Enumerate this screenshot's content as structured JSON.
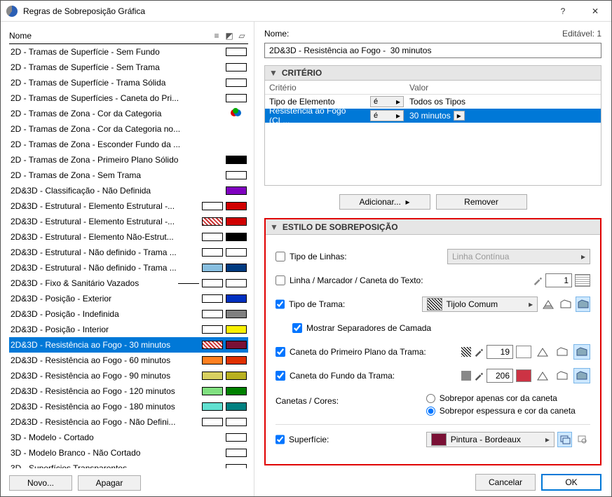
{
  "window": {
    "title": "Regras de Sobreposição Gráfica"
  },
  "left": {
    "header": "Nome",
    "buttons": {
      "new": "Novo...",
      "delete": "Apagar"
    },
    "items": [
      {
        "label": "2D - Tramas de Superfície - Sem Fundo",
        "sw": [
          {
            "c": "#ffffff"
          }
        ]
      },
      {
        "label": "2D - Tramas de Superfície - Sem Trama",
        "sw": [
          {
            "c": "#ffffff"
          }
        ]
      },
      {
        "label": "2D - Tramas de Superfície - Trama Sólida",
        "sw": [
          {
            "c": "#ffffff"
          }
        ]
      },
      {
        "label": "2D - Tramas de Superfícies - Caneta do Pri...",
        "sw": [
          {
            "c": "#ffffff"
          }
        ]
      },
      {
        "label": "2D - Tramas de Zona - Cor da Categoria",
        "category": true
      },
      {
        "label": "2D - Tramas de Zona - Cor da Categoria no...",
        "sw": []
      },
      {
        "label": "2D - Tramas de Zona - Esconder Fundo da ...",
        "sw": []
      },
      {
        "label": "2D - Tramas de Zona - Primeiro Plano Sólido",
        "sw": [
          {
            "c": "#000000"
          }
        ]
      },
      {
        "label": "2D - Tramas de Zona - Sem Trama",
        "sw": [
          {
            "c": "#ffffff"
          }
        ]
      },
      {
        "label": "2D&3D - Classificação - Não Definida",
        "sw": [
          {
            "c": "#8000c0"
          }
        ]
      },
      {
        "label": "2D&3D - Estrutural - Elemento Estrutural -...",
        "sw": [
          {
            "c": "#ffffff"
          },
          {
            "c": "#d00000"
          }
        ]
      },
      {
        "label": "2D&3D - Estrutural - Elemento Estrutural -...",
        "sw": [
          {
            "c": "#ffffff",
            "hatch": true
          },
          {
            "c": "#d00000"
          }
        ]
      },
      {
        "label": "2D&3D - Estrutural - Elemento Não-Estrut...",
        "sw": [
          {
            "c": "#ffffff"
          },
          {
            "c": "#000000"
          }
        ]
      },
      {
        "label": "2D&3D - Estrutural - Não definido - Trama ...",
        "sw": [
          {
            "c": "#ffffff"
          },
          {
            "c": "#ffffff"
          }
        ]
      },
      {
        "label": "2D&3D - Estrutural - Não definido - Trama ...",
        "sw": [
          {
            "c": "#88bfe0"
          },
          {
            "c": "#003a80"
          }
        ]
      },
      {
        "label": "2D&3D - Fixo & Sanitário Vazados",
        "line": true,
        "sw": [
          {
            "c": "#ffffff"
          },
          {
            "c": "#ffffff"
          }
        ]
      },
      {
        "label": "2D&3D - Posição - Exterior",
        "sw": [
          {
            "c": "#ffffff"
          },
          {
            "c": "#0030c0"
          }
        ]
      },
      {
        "label": "2D&3D - Posição - Indefinida",
        "sw": [
          {
            "c": "#ffffff"
          },
          {
            "c": "#808080"
          }
        ]
      },
      {
        "label": "2D&3D - Posição - Interior",
        "sw": [
          {
            "c": "#ffffff"
          },
          {
            "c": "#f8f000"
          }
        ]
      },
      {
        "label": "2D&3D - Resistência ao Fogo -  30 minutos",
        "selected": true,
        "sw": [
          {
            "c": "#ffffff",
            "hatch": true
          },
          {
            "c": "#7a1035"
          }
        ]
      },
      {
        "label": "2D&3D - Resistência ao Fogo -  60 minutos",
        "sw": [
          {
            "c": "#ff8020"
          },
          {
            "c": "#e03000"
          }
        ]
      },
      {
        "label": "2D&3D - Resistência ao Fogo -  90 minutos",
        "sw": [
          {
            "c": "#d8d060"
          },
          {
            "c": "#b8b020"
          }
        ]
      },
      {
        "label": "2D&3D - Resistência ao Fogo - 120 minutos",
        "sw": [
          {
            "c": "#80e080"
          },
          {
            "c": "#008000"
          }
        ]
      },
      {
        "label": "2D&3D - Resistência ao Fogo - 180 minutos",
        "sw": [
          {
            "c": "#60e0d0"
          },
          {
            "c": "#008080"
          }
        ]
      },
      {
        "label": "2D&3D - Resistência ao Fogo - Não Defini...",
        "sw": [
          {
            "c": "#ffffff"
          },
          {
            "c": "#ffffff"
          }
        ]
      },
      {
        "label": "3D - Modelo - Cortado",
        "sw": [
          {
            "c": "#ffffff"
          }
        ]
      },
      {
        "label": "3D - Modelo Branco - Não Cortado",
        "sw": [
          {
            "c": "#ffffff"
          }
        ]
      },
      {
        "label": "3D - Superfícies Transparentes",
        "sw": [
          {
            "c": "#ffffff"
          }
        ]
      }
    ]
  },
  "right": {
    "name_label": "Nome:",
    "editable": "Editável: 1",
    "name_value": "2D&3D - Resistência ao Fogo -  30 minutos",
    "criterio": {
      "title": "CRITÉRIO",
      "col_criterio": "Critério",
      "col_valor": "Valor",
      "rows": [
        {
          "c": "Tipo de Elemento",
          "op": "é",
          "v": "Todos os Tipos",
          "sel": false
        },
        {
          "c": "Resistência ao Fogo (CL...",
          "op": "é",
          "v": "30 minutos",
          "sel": true
        }
      ],
      "add": "Adicionar...",
      "remove": "Remover"
    },
    "override": {
      "title": "ESTILO DE SOBREPOSIÇÃO",
      "linetype": {
        "label": "Tipo de Linhas:",
        "value": "Linha Contínua",
        "checked": false
      },
      "linepen": {
        "label": "Linha / Marcador / Caneta do Texto:",
        "value": "1",
        "checked": false
      },
      "filltype": {
        "label": "Tipo de Trama:",
        "value": "Tijolo Comum",
        "checked": true
      },
      "showsep": {
        "label": "Mostrar Separadores de Camada",
        "checked": true
      },
      "fgpen": {
        "label": "Caneta do Primeiro Plano da Trama:",
        "value": "19",
        "checked": true
      },
      "bgpen": {
        "label": "Caneta do Fundo da Trama:",
        "value": "206",
        "color": "#cc3344",
        "checked": true
      },
      "pens_label": "Canetas / Cores:",
      "radio1": "Sobrepor apenas cor da caneta",
      "radio2": "Sobrepor espessura e cor da caneta",
      "surface": {
        "label": "Superfície:",
        "value": "Pintura - Bordeaux",
        "color": "#7a1035",
        "checked": true
      }
    },
    "cancel": "Cancelar",
    "ok": "OK"
  }
}
